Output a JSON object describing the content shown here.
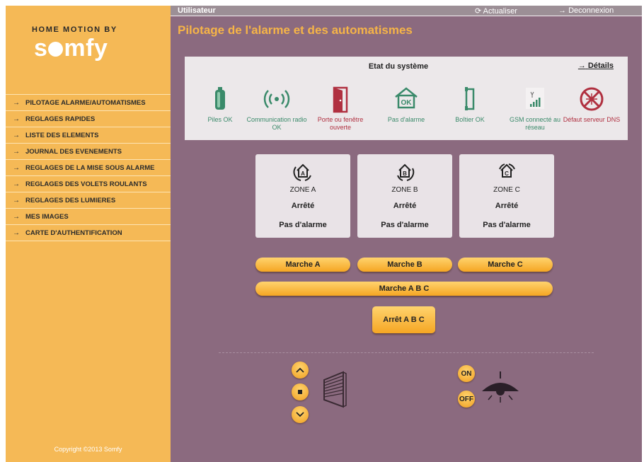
{
  "brand": {
    "top_text": "HOME MOTION BY",
    "logo_text_start": "s",
    "logo_text_end": "mfy"
  },
  "sidebar": {
    "items": [
      {
        "label": "PILOTAGE ALARME/AUTOMATISMES"
      },
      {
        "label": "REGLAGES RAPIDES"
      },
      {
        "label": "LISTE DES ELEMENTS"
      },
      {
        "label": "JOURNAL DES EVENEMENTS"
      },
      {
        "label": "REGLAGES DE LA MISE SOUS ALARME"
      },
      {
        "label": "REGLAGES DES VOLETS ROULANTS"
      },
      {
        "label": "REGLAGES DES LUMIERES"
      },
      {
        "label": "MES IMAGES"
      },
      {
        "label": "CARTE D'AUTHENTIFICATION"
      }
    ],
    "copyright": "Copyright ©2013 Somfy"
  },
  "topbar": {
    "user_label": "Utilisateur",
    "refresh_label": "Actualiser",
    "logout_label": "Deconnexion"
  },
  "page_title": "Pilotage de l'alarme et des automatismes",
  "status": {
    "title": "Etat du système",
    "details_label": "Détails",
    "items": [
      {
        "label": "Piles OK",
        "color": "#3a8a6a",
        "icon": "battery-icon"
      },
      {
        "label": "Communication radio OK",
        "color": "#3a8a6a",
        "icon": "radio-waves-icon"
      },
      {
        "label": "Porte ou fenêtre ouverte",
        "color": "#b03040",
        "icon": "open-door-icon"
      },
      {
        "label": "Pas d'alarme",
        "color": "#3a8a6a",
        "icon": "house-ok-icon"
      },
      {
        "label": "Boîtier OK",
        "color": "#3a8a6a",
        "icon": "box-icon"
      },
      {
        "label": "GSM connecté au réseau",
        "color": "#3a8a6a",
        "icon": "gsm-signal-icon"
      },
      {
        "label": "Défaut serveur DNS",
        "color": "#b03040",
        "icon": "server-error-icon"
      }
    ]
  },
  "zones": [
    {
      "letter": "A",
      "name": "ZONE A",
      "state": "Arrêté",
      "alarm": "Pas d'alarme"
    },
    {
      "letter": "B",
      "name": "ZONE B",
      "state": "Arrêté",
      "alarm": "Pas d'alarme"
    },
    {
      "letter": "C",
      "name": "ZONE C",
      "state": "Arrêté",
      "alarm": "Pas d'alarme"
    }
  ],
  "buttons": {
    "marche_a": "Marche A",
    "marche_b": "Marche B",
    "marche_c": "Marche C",
    "marche_abc": "Marche A B C",
    "arret_abc": "Arrêt A B C"
  },
  "shutters": {
    "up_icon": "chevron-up-icon",
    "stop_icon": "stop-icon",
    "down_icon": "chevron-down-icon"
  },
  "lights": {
    "on_label": "ON",
    "off_label": "OFF"
  },
  "colors": {
    "sidebar": "#f5b956",
    "main_bg": "#8b6a7f",
    "title": "#f6b447",
    "button": "#f5a623"
  }
}
